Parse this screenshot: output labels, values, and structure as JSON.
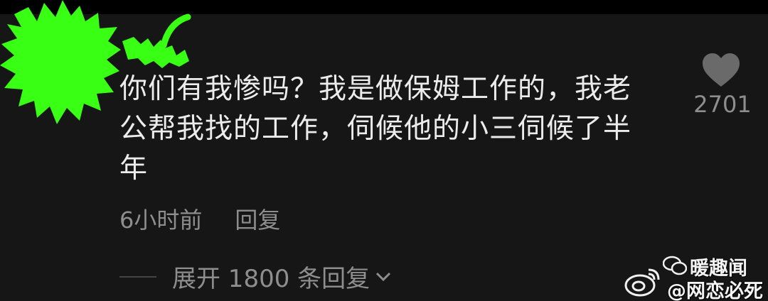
{
  "comment": {
    "text": "你们有我惨吗？我是做保姆工作的，我老\n公帮我找的工作，伺候他的小三伺候了半\n年",
    "time": "6小时前",
    "reply_label": "回复",
    "like_count": "2701",
    "expand_label": "展开 1800 条回复"
  },
  "watermark": {
    "brand": "暖趣闻",
    "handle": "@网恋必死"
  },
  "colors": {
    "background": "#161616",
    "text": "#ececec",
    "meta": "#8e8e8e",
    "redaction_scribble": "#39ff14"
  },
  "icons": [
    "green-redaction-avatar",
    "heart-icon",
    "chevron-down-icon",
    "weibo-icon",
    "wechat-icon"
  ]
}
